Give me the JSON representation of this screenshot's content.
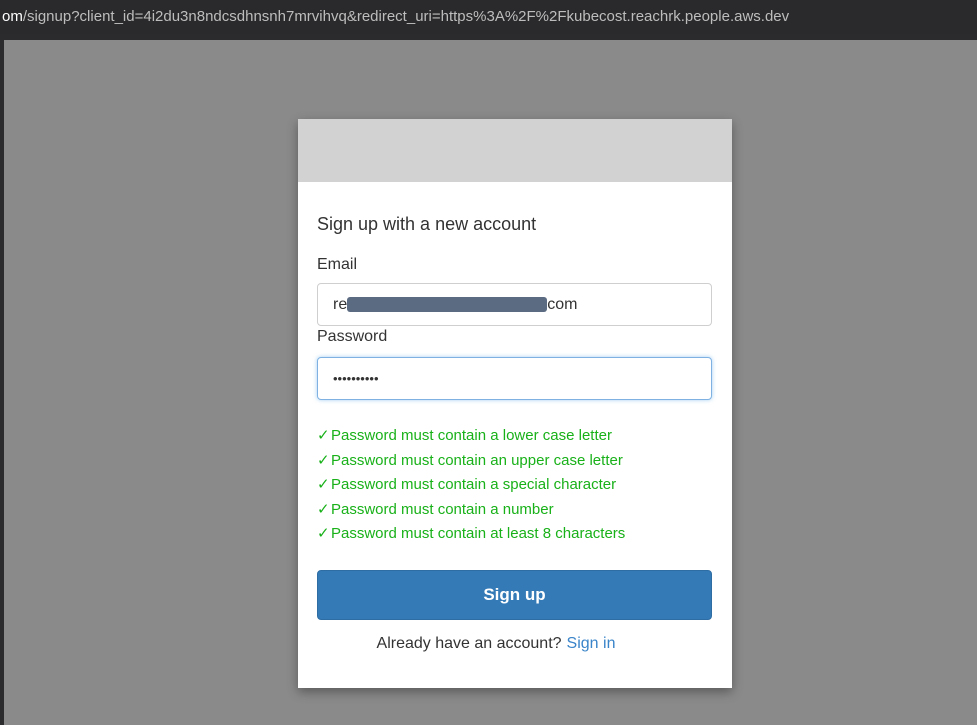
{
  "browser": {
    "url_host": "om",
    "url_path": "/signup?client_id=4i2du3n8ndcsdhnsnh7mrvihvq&redirect_uri=https%3A%2F%2Fkubecost.reachrk.people.aws.dev"
  },
  "signup_form": {
    "title": "Sign up with a new account",
    "email_label": "Email",
    "email_value_prefix": "re",
    "email_value_suffix": "com",
    "password_label": "Password",
    "password_value": "••••••••••",
    "rules": [
      "Password must contain a lower case letter",
      "Password must contain an upper case letter",
      "Password must contain a special character",
      "Password must contain a number",
      "Password must contain at least 8 characters"
    ],
    "rule_check_symbol": "✓",
    "signup_button_label": "Sign up",
    "already_have_account_text": "Already have an account?",
    "signin_link_label": "Sign in"
  },
  "colors": {
    "rule_ok": "#19b119",
    "primary_button": "#337ab7",
    "link": "#3a84c9",
    "backdrop": "#8a8a8a",
    "modal_header": "#d2d2d2"
  }
}
